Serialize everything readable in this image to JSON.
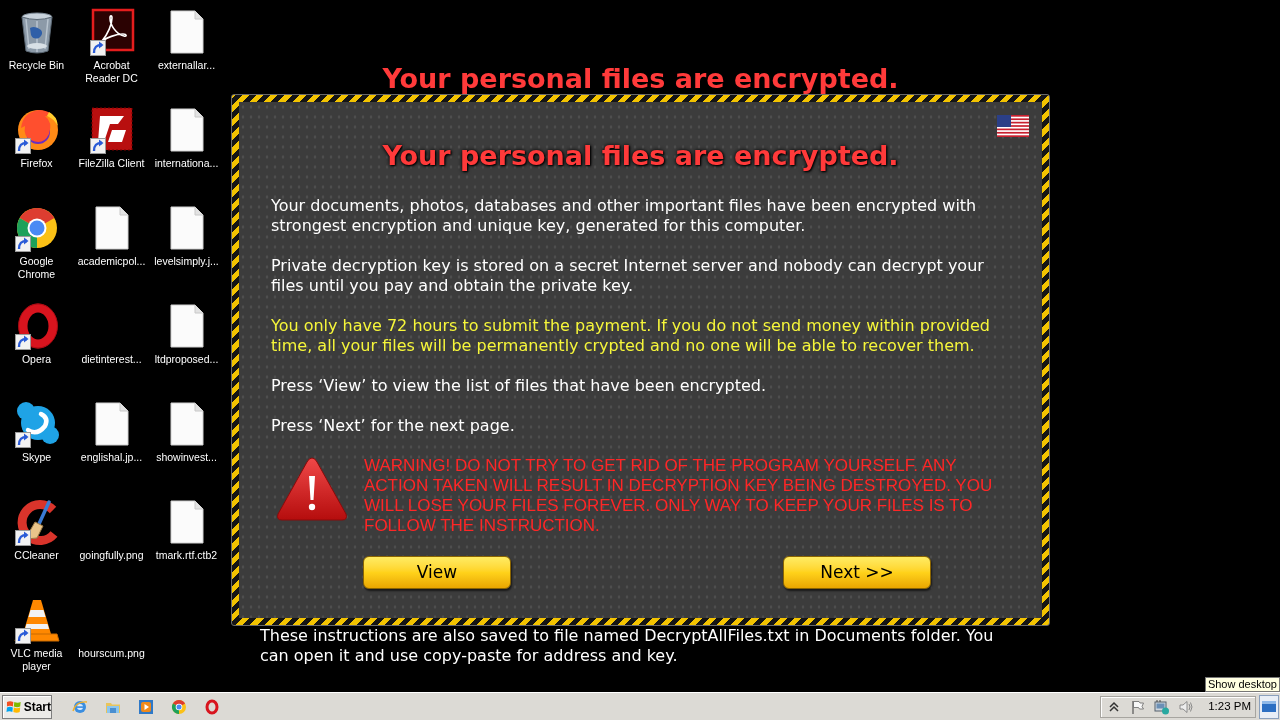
{
  "desktop": {
    "columns": [
      {
        "icons": [
          {
            "label": "Recycle Bin",
            "kind": "recycle-bin",
            "shortcut": false
          },
          {
            "label": "Firefox",
            "kind": "firefox",
            "shortcut": true
          },
          {
            "label": "Google Chrome",
            "kind": "chrome",
            "shortcut": true
          },
          {
            "label": "Opera",
            "kind": "opera",
            "shortcut": true
          },
          {
            "label": "Skype",
            "kind": "skype",
            "shortcut": true
          },
          {
            "label": "CCleaner",
            "kind": "ccleaner",
            "shortcut": true
          },
          {
            "label": "VLC media player",
            "kind": "vlc",
            "shortcut": true
          }
        ]
      },
      {
        "icons": [
          {
            "label": "Acrobat Reader DC",
            "kind": "acrobat",
            "shortcut": true
          },
          {
            "label": "FileZilla Client",
            "kind": "filezilla",
            "shortcut": true
          },
          {
            "label": "academicpol...",
            "kind": "document",
            "shortcut": false
          },
          {
            "label": "dietinterest...",
            "kind": "image",
            "shortcut": false
          },
          {
            "label": "englishal.jp...",
            "kind": "document",
            "shortcut": false
          },
          {
            "label": "goingfully.png",
            "kind": "image",
            "shortcut": false
          },
          {
            "label": "hourscum.png",
            "kind": "image",
            "shortcut": false
          }
        ]
      },
      {
        "icons": [
          {
            "label": "externallar...",
            "kind": "document",
            "shortcut": false
          },
          {
            "label": "internationa...",
            "kind": "document",
            "shortcut": false
          },
          {
            "label": "levelsimply.j...",
            "kind": "document",
            "shortcut": false
          },
          {
            "label": "ltdproposed...",
            "kind": "document",
            "shortcut": false
          },
          {
            "label": "showinvest...",
            "kind": "document",
            "shortcut": false
          },
          {
            "label": "tmark.rtf.ctb2",
            "kind": "document",
            "shortcut": false
          }
        ]
      }
    ]
  },
  "ransom_note": {
    "header": "Your personal files are encrypted.",
    "title": "Your personal files are encrypted.",
    "paragraphs": [
      {
        "text": "Your documents, photos, databases and other important files have been encrypted with strongest encryption and unique key, generated for this computer.",
        "highlighted": false
      },
      {
        "text": "Private decryption key is stored on a secret Internet server and nobody can decrypt your files until you pay and obtain the private key.",
        "highlighted": false
      },
      {
        "text": "You only have 72 hours to submit the payment. If you do not send money within provided time, all your files will be permanently crypted and no one will be able to recover them.",
        "highlighted": true
      },
      {
        "text": "Press ‘View’ to view the list of files that have been encrypted.",
        "highlighted": false
      },
      {
        "text": "Press ‘Next’ for the next page.",
        "highlighted": false
      }
    ],
    "warning": "WARNING! DO NOT TRY TO GET RID OF THE PROGRAM YOURSELF. ANY ACTION TAKEN WILL RESULT IN DECRYPTION KEY BEING DESTROYED. YOU WILL LOSE YOUR FILES FOREVER. ONLY WAY TO KEEP YOUR FILES IS TO FOLLOW THE INSTRUCTION.",
    "buttons": [
      {
        "label": "View"
      },
      {
        "label": "Next >>"
      }
    ],
    "footer": "These instructions are also saved to file named DecryptAllFiles.txt in Documents folder. You can open it and use copy-paste for address and key."
  },
  "tooltip": "Show desktop",
  "taskbar": {
    "start": "Start",
    "quick_launch": [
      {
        "kind": "ie"
      },
      {
        "kind": "explorer"
      },
      {
        "kind": "media-player"
      },
      {
        "kind": "chrome"
      },
      {
        "kind": "opera"
      }
    ],
    "tray": [
      {
        "kind": "chevron"
      },
      {
        "kind": "flag"
      },
      {
        "kind": "network"
      },
      {
        "kind": "speaker"
      }
    ],
    "clock": "1:23 PM"
  }
}
